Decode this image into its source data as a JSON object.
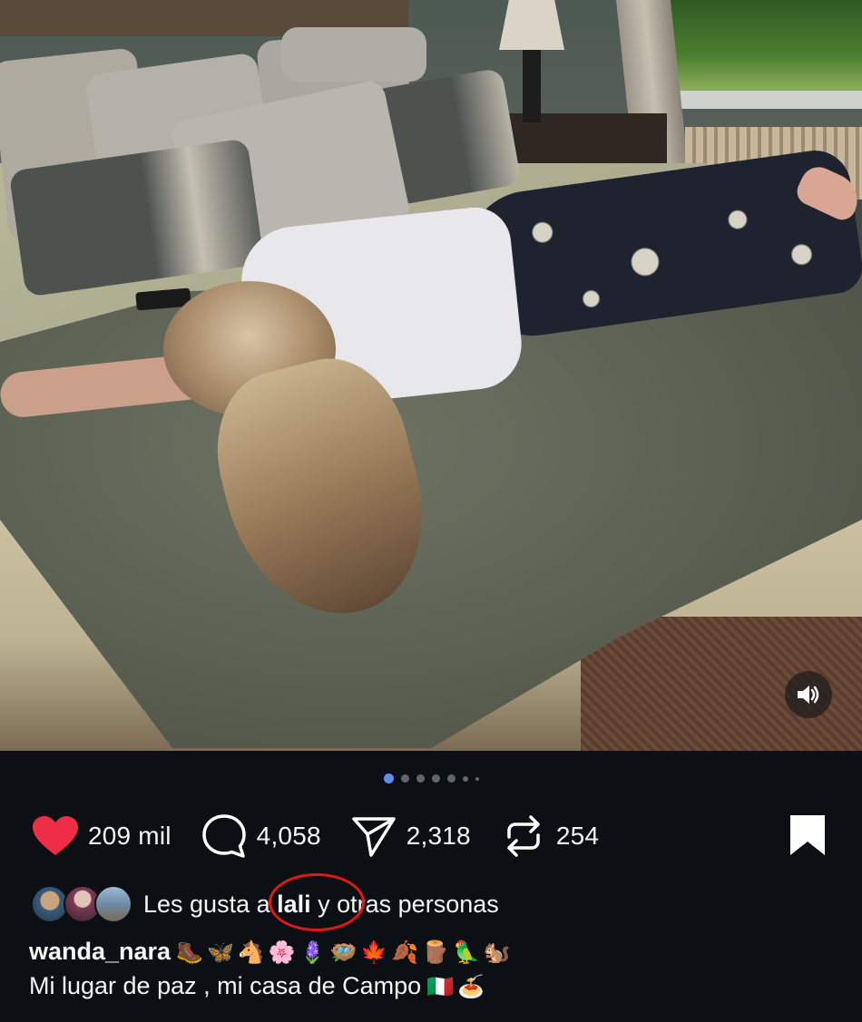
{
  "post": {
    "image_description_icon": "photo",
    "sound_icon": "speaker-icon",
    "carousel": {
      "total_dots": 7,
      "active_index": 0
    }
  },
  "actions": {
    "likes": "209 mil",
    "comments": "4,058",
    "shares": "2,318",
    "reposts": "254"
  },
  "liked_by": {
    "prefix": "Les gusta a ",
    "user": "lali",
    "suffix": " y otras personas"
  },
  "caption": {
    "username": "wanda_nara",
    "username_emojis": "🥾🦋🐴🌸🪻🪺🍁🍂🪵🦜🐿️",
    "text": "Mi lugar de paz , mi casa de Campo",
    "text_emojis": "🇮🇹🍝"
  },
  "colors": {
    "background": "#0c1014",
    "like_heart": "#ed2e46",
    "active_dot": "#5b8ff5",
    "annotation_circle": "#e01818"
  }
}
